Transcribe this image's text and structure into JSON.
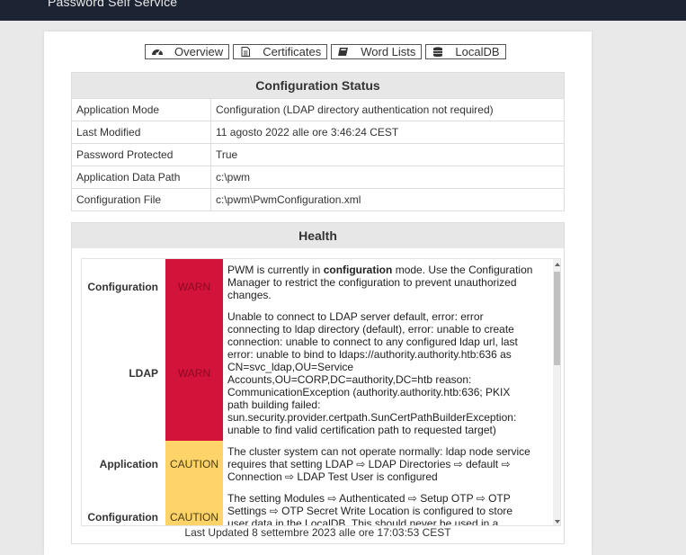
{
  "header": {
    "title": "Password Self Service"
  },
  "tabs": [
    {
      "label": "Overview",
      "icon": "dashboard-icon"
    },
    {
      "label": "Certificates",
      "icon": "file-text-icon"
    },
    {
      "label": "Word Lists",
      "icon": "book-icon"
    },
    {
      "label": "LocalDB",
      "icon": "database-icon"
    }
  ],
  "config_status": {
    "title": "Configuration Status",
    "rows": [
      {
        "key": "Application Mode",
        "value": "Configuration (LDAP directory authentication not required)"
      },
      {
        "key": "Last Modified",
        "value": "11 agosto 2022 alle ore 3:46:24 CEST"
      },
      {
        "key": "Password Protected",
        "value": "True"
      },
      {
        "key": "Application Data Path",
        "value": "c:\\pwm"
      },
      {
        "key": "Configuration File",
        "value": "c:\\pwm\\PwmConfiguration.xml"
      }
    ]
  },
  "health": {
    "title": "Health",
    "colors": {
      "warn": "#d4133a",
      "caution": "#fdd36a"
    },
    "records": [
      {
        "topic": "Configuration",
        "status": "WARN",
        "msg_pre": "PWM is currently in ",
        "msg_bold": "configuration",
        "msg_post": " mode. Use the Configuration Manager to restrict the configuration to prevent unauthorized changes."
      },
      {
        "topic": "LDAP",
        "status": "WARN",
        "msg": "Unable to connect to LDAP server default, error: error connecting to ldap directory (default), error: unable to create connection: unable to connect to any configured ldap url, last error: unable to bind to ldaps://authority.authority.htb:636 as CN=svc_ldap,OU=Service Accounts,OU=CORP,DC=authority,DC=htb reason: CommunicationException (authority.authority.htb:636; PKIX path building failed: sun.security.provider.certpath.SunCertPathBuilderException: unable to find valid certification path to requested target)"
      },
      {
        "topic": "Application",
        "status": "CAUTION",
        "msg": "The cluster system can not operate normally: ldap node service requires that setting LDAP ⇨ LDAP Directories ⇨ default ⇨ Connection ⇨ LDAP Test User is configured"
      },
      {
        "topic": "Configuration",
        "status": "CAUTION",
        "msg": "The setting Modules ⇨ Authenticated ⇨ Setup OTP ⇨ OTP Settings ⇨ OTP Secret Write Location is configured to store user data in the LocalDB. This should never be used in a"
      }
    ],
    "last_updated": "Last Updated 8 settembre 2023 alle ore 17:03:53 CEST"
  }
}
